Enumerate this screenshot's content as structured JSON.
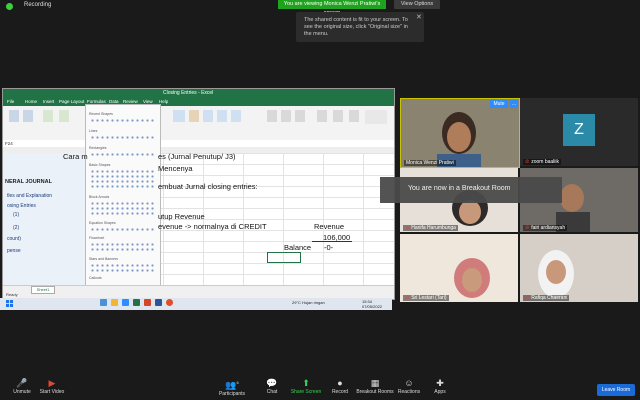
{
  "top_bar": {
    "recording_label": "Recording",
    "share_banner": "You are viewing Monica Wenzi Pratiwi's screen",
    "view_options": "View Options",
    "tooltip_text": "The shared content is fit to your screen. To see the original size, click \"Original size\" in the menu.",
    "tooltip_close": "✕"
  },
  "excel": {
    "title": "Closing Entries - Excel",
    "tabs": [
      "File",
      "Home",
      "Insert",
      "Page Layout",
      "Formulas",
      "Data",
      "Review",
      "View",
      "Help"
    ],
    "name_box": "F24",
    "sheet_tab": "Sheet1",
    "status": "Ready",
    "shapes_panel": {
      "title": "Recent Shapes",
      "sections": [
        "Lines",
        "Rectangles",
        "Basic Shapes",
        "Block Arrows",
        "Equation Shapes",
        "Flowchart",
        "Stars and Banners",
        "Callouts"
      ]
    },
    "left_pane": {
      "header": "NERAL JOURNAL",
      "sub1": "tles and Explanation",
      "sub2": "osing Entries",
      "items": [
        "(1)",
        "(2)",
        "count)",
        "pense"
      ]
    },
    "cells": {
      "line1_a": "Cara m",
      "line1_b": "es (Jurnal Penutup/ J3)",
      "line2": "Mencenya",
      "line3": "embuat Jurnal closing entries:",
      "line4": "utup Revenue",
      "line5": "evenue -> normalnya di CREDIT",
      "revenue_label": "Revenue",
      "revenue_value": "106,000",
      "balance_label": "Balance",
      "balance_value": "-0-"
    },
    "taskbar_time": "15:34",
    "taskbar_date": "07/05/2022",
    "taskbar_weather": "29°C Hujan ringan"
  },
  "participants": [
    {
      "name": "Monica Wenzi Pratiwi",
      "muted": false
    },
    {
      "name": "zoom baaliik",
      "muted": true,
      "initial": "Z"
    },
    {
      "name": "Hanifa Harumbunga",
      "muted": true
    },
    {
      "name": "fairi ardiansyah",
      "muted": true
    },
    {
      "name": "Sri Lestari (Tari)",
      "muted": true
    },
    {
      "name": "Rafiqa Chaerani",
      "muted": true
    }
  ],
  "mute_button": "Mute",
  "more_button": "…",
  "breakout_toast": "You are now in a Breakout Room",
  "toolbar": {
    "items": [
      {
        "label": "Unmute",
        "icon": "🎤"
      },
      {
        "label": "Start Video",
        "icon": "▶"
      },
      {
        "label": "Participants",
        "icon": "👥",
        "count": "6"
      },
      {
        "label": "Chat",
        "icon": "💬"
      },
      {
        "label": "Share Screen",
        "icon": "⬆"
      },
      {
        "label": "Record",
        "icon": "●"
      },
      {
        "label": "Breakout Rooms",
        "icon": "▦"
      },
      {
        "label": "Reactions",
        "icon": "☺"
      },
      {
        "label": "Apps",
        "icon": "✚"
      }
    ],
    "leave": "Leave Room"
  },
  "colors": {
    "accent": "#2d8cff",
    "excel_green": "#217346",
    "share_green": "#1fa31f",
    "leave_blue": "#1a6ad8"
  }
}
